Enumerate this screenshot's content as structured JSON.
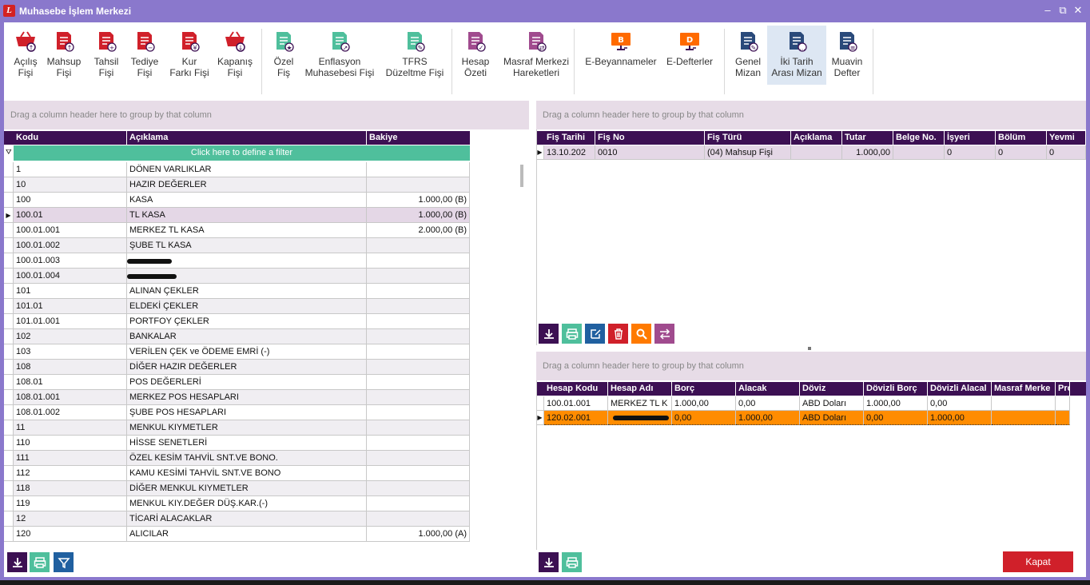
{
  "window": {
    "title": "Muhasebe İşlem Merkezi"
  },
  "ribbon": {
    "buttons": [
      {
        "label": "Açılış\nFişi",
        "icon": "basket-up-icon"
      },
      {
        "label": "Mahsup\nFişi",
        "icon": "doc-up-icon"
      },
      {
        "label": "Tahsil\nFişi",
        "icon": "doc-plus-icon"
      },
      {
        "label": "Tediye\nFişi",
        "icon": "doc-minus-icon"
      },
      {
        "label": "Kur\nFarkı Fişi",
        "icon": "currency-doc-icon"
      },
      {
        "label": "Kapanış\nFişi",
        "icon": "basket-down-icon"
      },
      {
        "label": "Özel\nFiş",
        "icon": "star-doc-icon"
      },
      {
        "label": "Enflasyon\nMuhasebesi Fişi",
        "icon": "chart-doc-icon"
      },
      {
        "label": "TFRS\nDüzeltme Fişi",
        "icon": "edit-doc-icon"
      },
      {
        "label": "Hesap\nÖzeti",
        "icon": "check-doc-icon"
      },
      {
        "label": "Masraf Merkezi\nHareketleri",
        "icon": "transfer-doc-icon"
      },
      {
        "label": "E-Beyannameler",
        "icon": "e-monitor-b-icon"
      },
      {
        "label": "E-Defterler",
        "icon": "e-monitor-d-icon"
      },
      {
        "label": "Genel\nMizan",
        "icon": "ledger-pen-icon"
      },
      {
        "label": "İki Tarih\nArası Mizan",
        "icon": "ledger-dots-icon"
      },
      {
        "label": "Muavin\nDefter",
        "icon": "ledger-list-icon"
      }
    ]
  },
  "left_grid": {
    "group_hint": "Drag a column header here to group by that column",
    "filter_hint": "Click here to define a filter",
    "headers": [
      "Kodu",
      "Açıklama",
      "Bakiye"
    ],
    "rows": [
      {
        "kodu": "1",
        "aciklama": "DÖNEN VARLIKLAR",
        "bakiye": ""
      },
      {
        "kodu": "10",
        "aciklama": "HAZIR DEĞERLER",
        "bakiye": ""
      },
      {
        "kodu": "100",
        "aciklama": "KASA",
        "bakiye": "1.000,00 (B)"
      },
      {
        "kodu": "100.01",
        "aciklama": "TL KASA",
        "bakiye": "1.000,00 (B)"
      },
      {
        "kodu": "100.01.001",
        "aciklama": "MERKEZ TL KASA",
        "bakiye": "2.000,00 (B)"
      },
      {
        "kodu": "100.01.002",
        "aciklama": "ŞUBE TL KASA",
        "bakiye": ""
      },
      {
        "kodu": "100.01.003",
        "aciklama": "",
        "bakiye": ""
      },
      {
        "kodu": "100.01.004",
        "aciklama": "",
        "bakiye": ""
      },
      {
        "kodu": "101",
        "aciklama": "ALINAN ÇEKLER",
        "bakiye": ""
      },
      {
        "kodu": "101.01",
        "aciklama": "ELDEKİ ÇEKLER",
        "bakiye": ""
      },
      {
        "kodu": "101.01.001",
        "aciklama": "PORTFOY ÇEKLER",
        "bakiye": ""
      },
      {
        "kodu": "102",
        "aciklama": "BANKALAR",
        "bakiye": ""
      },
      {
        "kodu": "103",
        "aciklama": "VERİLEN ÇEK ve ÖDEME EMRİ (-)",
        "bakiye": ""
      },
      {
        "kodu": "108",
        "aciklama": "DİĞER HAZIR DEĞERLER",
        "bakiye": ""
      },
      {
        "kodu": "108.01",
        "aciklama": "POS DEĞERLERİ",
        "bakiye": ""
      },
      {
        "kodu": "108.01.001",
        "aciklama": "MERKEZ POS HESAPLARI",
        "bakiye": ""
      },
      {
        "kodu": "108.01.002",
        "aciklama": "ŞUBE POS HESAPLARI",
        "bakiye": ""
      },
      {
        "kodu": "11",
        "aciklama": "MENKUL KIYMETLER",
        "bakiye": ""
      },
      {
        "kodu": "110",
        "aciklama": "HİSSE SENETLERİ",
        "bakiye": ""
      },
      {
        "kodu": "111",
        "aciklama": "ÖZEL KESİM TAHVİL SNT.VE BONO.",
        "bakiye": ""
      },
      {
        "kodu": "112",
        "aciklama": "KAMU KESİMİ TAHVİL SNT.VE BONO",
        "bakiye": ""
      },
      {
        "kodu": "118",
        "aciklama": "DİĞER MENKUL KIYMETLER",
        "bakiye": ""
      },
      {
        "kodu": "119",
        "aciklama": "MENKUL KIY.DEĞER DÜŞ.KAR.(-)",
        "bakiye": ""
      },
      {
        "kodu": "12",
        "aciklama": "TİCARİ ALACAKLAR",
        "bakiye": ""
      },
      {
        "kodu": "120",
        "aciklama": "ALICILAR",
        "bakiye": "1.000,00 (A)"
      }
    ]
  },
  "top_right_grid": {
    "group_hint": "Drag a column header here to group by that column",
    "headers": [
      "Fiş Tarihi",
      "Fiş No",
      "Fiş Türü",
      "Açıklama",
      "Tutar",
      "Belge No.",
      "İşyeri",
      "Bölüm",
      "Yevmi"
    ],
    "rows": [
      {
        "cells": [
          "13.10.202",
          "0010",
          "(04) Mahsup Fişi",
          "",
          "1.000,00",
          "",
          "0",
          "0",
          "0"
        ]
      }
    ]
  },
  "bottom_right_grid": {
    "group_hint": "Drag a column header here to group by that column",
    "headers": [
      "Hesap Kodu",
      "Hesap Adı",
      "Borç",
      "Alacak",
      "Döviz",
      "Dövizli Borç",
      "Dövizli Alacal",
      "Masraf Merke",
      "Proje"
    ],
    "rows": [
      {
        "cells": [
          "100.01.001",
          "MERKEZ TL K",
          "1.000,00",
          "0,00",
          "ABD Doları",
          "1.000,00",
          "0,00",
          "",
          ""
        ]
      },
      {
        "cells": [
          "120.02.001",
          "",
          "0,00",
          "1.000,00",
          "ABD Doları",
          "0,00",
          "1.000,00",
          "",
          ""
        ]
      }
    ]
  },
  "footer": {
    "close_label": "Kapat"
  },
  "colors": {
    "header": "#3c1053",
    "selected_row": "#ff8c00",
    "accent": "#d0202a",
    "filter": "#4fbf9c",
    "group_bar": "#e7dce7"
  }
}
